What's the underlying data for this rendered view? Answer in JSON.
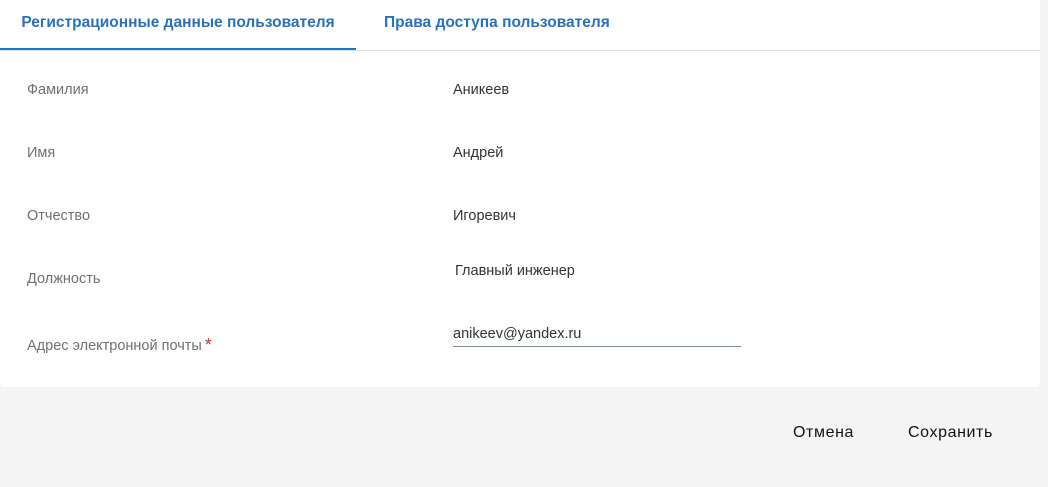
{
  "tabs": [
    {
      "label": "Регистрационные данные пользователя",
      "active": true
    },
    {
      "label": "Права доступа пользователя",
      "active": false
    }
  ],
  "form": {
    "last_name": {
      "label": "Фамилия",
      "value": "Аникеев"
    },
    "first_name": {
      "label": "Имя",
      "value": "Андрей"
    },
    "patronymic": {
      "label": "Отчество",
      "value": "Игоревич"
    },
    "position": {
      "label": "Должность",
      "value": "Главный инженер"
    },
    "email": {
      "label": "Адрес электронной почты",
      "required_mark": "*",
      "value": "anikeev@yandex.ru"
    }
  },
  "footer": {
    "cancel_label": "Отмена",
    "save_label": "Сохранить"
  },
  "colors": {
    "accent": "#2a72b8",
    "required": "#d3362b",
    "footer_bg": "#f4f4f4"
  }
}
